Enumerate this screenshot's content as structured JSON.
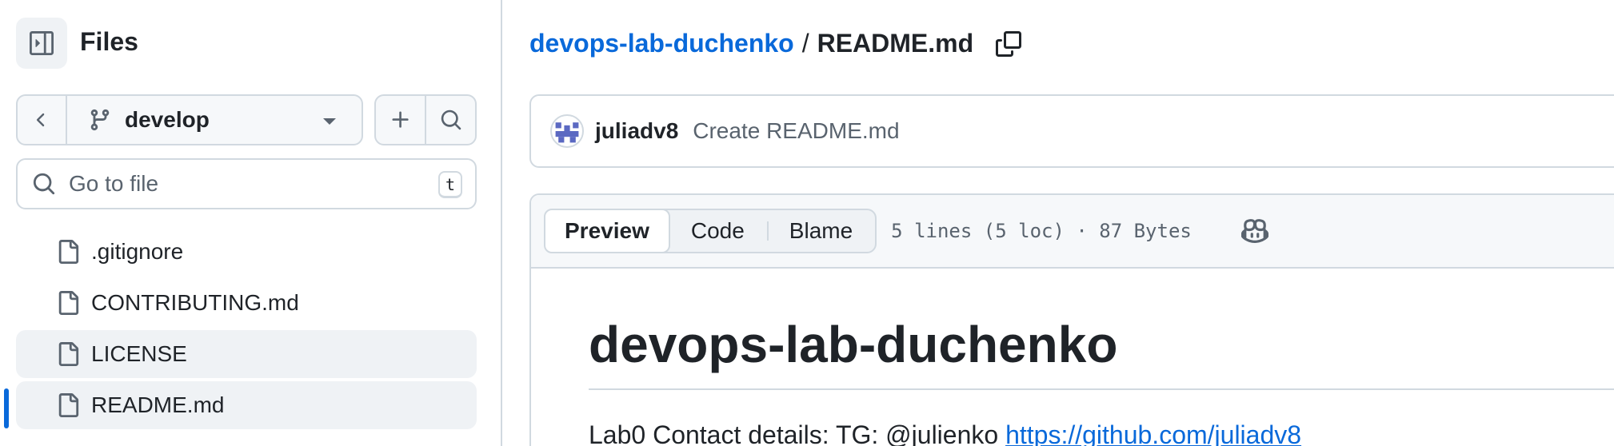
{
  "sidebar": {
    "title": "Files",
    "branch": "develop",
    "goto_placeholder": "Go to file",
    "goto_shortcut": "t",
    "files": [
      {
        "name": ".gitignore",
        "state": "normal"
      },
      {
        "name": "CONTRIBUTING.md",
        "state": "normal"
      },
      {
        "name": "LICENSE",
        "state": "hover"
      },
      {
        "name": "README.md",
        "state": "selected"
      }
    ]
  },
  "breadcrumb": {
    "repo": "devops-lab-duchenko",
    "separator": "/",
    "file": "README.md"
  },
  "commit": {
    "author": "juliadv8",
    "message": "Create README.md"
  },
  "file_view": {
    "tabs": [
      "Preview",
      "Code",
      "Blame"
    ],
    "active_tab": "Preview",
    "meta": "5 lines (5 loc) · 87 Bytes"
  },
  "readme": {
    "heading": "devops-lab-duchenko",
    "line_text": "Lab0 Contact details: TG: @julienko ",
    "line_link": "https://github.com/juliadv8"
  },
  "colors": {
    "accent": "#0969da",
    "border": "#d1d9e0",
    "muted_bg": "#f6f8fa",
    "text": "#1f2328",
    "muted_text": "#59636e"
  }
}
